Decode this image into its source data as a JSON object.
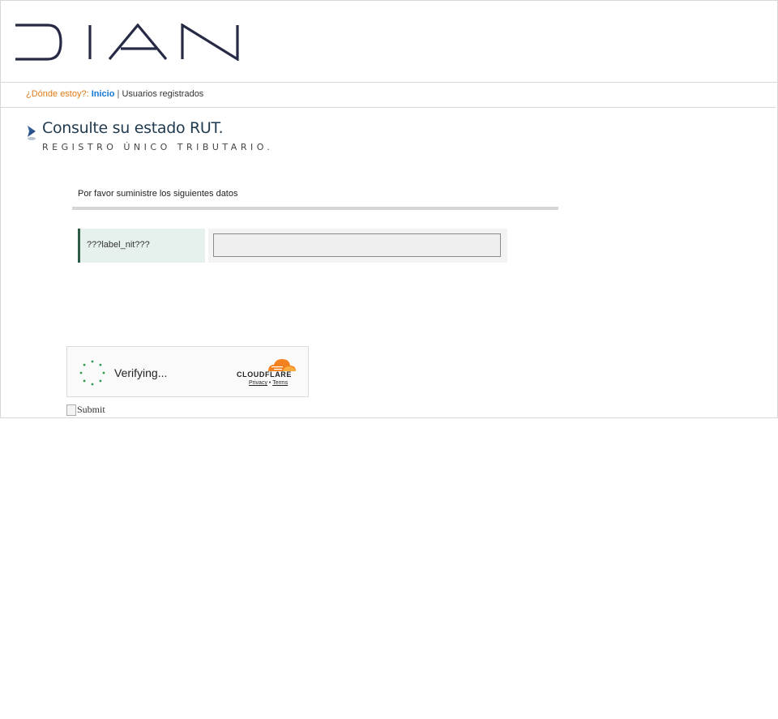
{
  "header": {
    "logo_text": "DIAN"
  },
  "breadcrumb": {
    "prefix": "¿Dónde estoy?:",
    "home_link": "Inicio",
    "separator": "|",
    "current": "Usuarios registrados"
  },
  "page": {
    "title": "Consulte su estado RUT.",
    "subtitle": "REGISTRO ÚNICO TRIBUTARIO."
  },
  "form": {
    "instructions": "Por favor suministre los siguientes datos",
    "nit_label": "???label_nit???",
    "nit_value": ""
  },
  "captcha": {
    "status": "Verifying...",
    "brand": "CLOUDFLARE",
    "privacy_link": "Privacy",
    "link_separator": "•",
    "terms_link": "Terms"
  },
  "submit": {
    "alt_text": "Submit"
  },
  "colors": {
    "breadcrumb_prefix": "#e07a14",
    "link": "#1478d4",
    "title": "#1f3a4f",
    "label_bg": "#e6f0ec",
    "label_border": "#2d5c46",
    "cloudflare_orange": "#f48120",
    "spinner_green": "#2e9c4e"
  },
  "icons": {
    "title_marker": "arrow-right-icon",
    "captcha_spinner": "loading-spinner-icon",
    "cloudflare": "cloudflare-cloud-icon",
    "submit_image": "broken-image-icon"
  }
}
